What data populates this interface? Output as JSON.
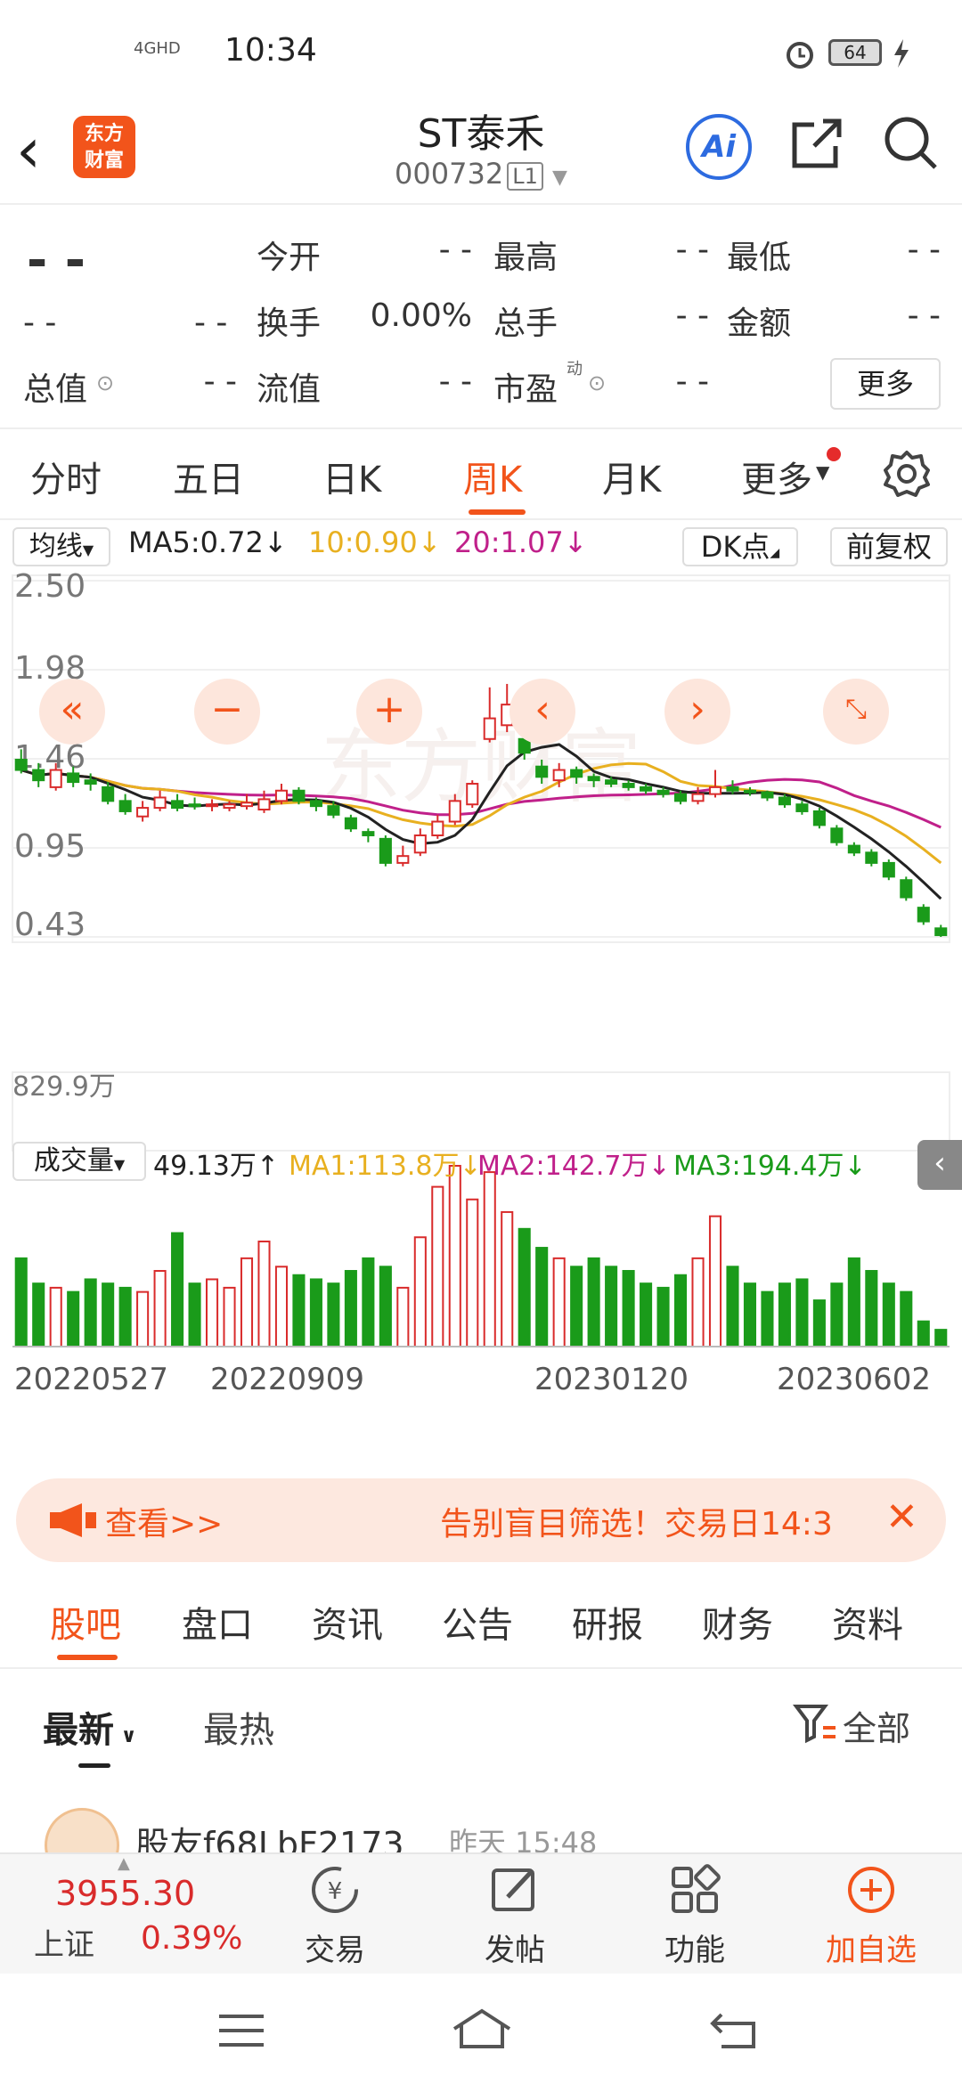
{
  "status_bar": {
    "time": "10:34",
    "network": "4GHD",
    "battery": "64"
  },
  "header": {
    "title": "ST泰禾",
    "code": "000732",
    "level": "L1",
    "logo_line1": "东方",
    "logo_line2": "财富",
    "ai_label": "Ai"
  },
  "quote": {
    "price": "- -",
    "change": "- -",
    "change_pct": "- -",
    "rows": [
      [
        {
          "label": "今开",
          "value": "- -"
        },
        {
          "label": "最高",
          "value": "- -"
        },
        {
          "label": "最低",
          "value": "- -"
        }
      ],
      [
        {
          "label": "换手",
          "value": "0.00%"
        },
        {
          "label": "总手",
          "value": "- -"
        },
        {
          "label": "金额",
          "value": "- -"
        }
      ],
      [
        {
          "label": "总值",
          "value": "- -"
        },
        {
          "label": "流值",
          "value": "- -"
        },
        {
          "label": "市盈",
          "value": "- -"
        }
      ]
    ],
    "pe_sup": "动",
    "more_label": "更多"
  },
  "chart_tabs": {
    "items": [
      "分时",
      "五日",
      "日K",
      "周K",
      "月K",
      "更多"
    ],
    "active": "周K"
  },
  "indicator": {
    "ma_type": "均线",
    "ma5": "MA5:0.72↓",
    "ma10": "10:0.90↓",
    "ma20": "20:1.07↓",
    "dk": "DK点",
    "fq": "前复权"
  },
  "price_axis": {
    "labels": [
      "2.50",
      "1.98",
      "1.46",
      "0.95",
      "0.43"
    ]
  },
  "volume": {
    "label": "成交量",
    "value": "49.13万↑",
    "ma1": "MA1:113.8万↓",
    "ma2": "MA2:142.7万↓",
    "ma3": "MA3:194.4万↓",
    "max_label": "829.9万"
  },
  "date_axis": [
    "20220527",
    "20220909",
    "20230120",
    "20230602"
  ],
  "colors": {
    "up": "#d92b2b",
    "down": "#1a9b1a",
    "ma5": "#222222",
    "ma10": "#e8b020",
    "ma20": "#c0208a",
    "accent": "#f2541b"
  },
  "chart_data": {
    "type": "candlestick",
    "ma5": 0.72,
    "ma10": 0.9,
    "ma20": 1.07,
    "ylim": [
      0.43,
      2.5
    ],
    "candles": [
      {
        "o": 1.46,
        "c": 1.4,
        "h": 1.52,
        "l": 1.38
      },
      {
        "o": 1.4,
        "c": 1.34,
        "h": 1.44,
        "l": 1.3
      },
      {
        "o": 1.3,
        "c": 1.4,
        "h": 1.44,
        "l": 1.28
      },
      {
        "o": 1.38,
        "c": 1.33,
        "h": 1.42,
        "l": 1.3
      },
      {
        "o": 1.34,
        "c": 1.32,
        "h": 1.38,
        "l": 1.28
      },
      {
        "o": 1.3,
        "c": 1.22,
        "h": 1.33,
        "l": 1.2
      },
      {
        "o": 1.22,
        "c": 1.16,
        "h": 1.26,
        "l": 1.14
      },
      {
        "o": 1.13,
        "c": 1.18,
        "h": 1.22,
        "l": 1.1
      },
      {
        "o": 1.18,
        "c": 1.24,
        "h": 1.28,
        "l": 1.16
      },
      {
        "o": 1.22,
        "c": 1.18,
        "h": 1.26,
        "l": 1.16
      },
      {
        "o": 1.2,
        "c": 1.19,
        "h": 1.24,
        "l": 1.17
      },
      {
        "o": 1.19,
        "c": 1.2,
        "h": 1.23,
        "l": 1.16
      },
      {
        "o": 1.18,
        "c": 1.2,
        "h": 1.22,
        "l": 1.16
      },
      {
        "o": 1.19,
        "c": 1.21,
        "h": 1.26,
        "l": 1.17
      },
      {
        "o": 1.17,
        "c": 1.23,
        "h": 1.28,
        "l": 1.15
      },
      {
        "o": 1.22,
        "c": 1.28,
        "h": 1.32,
        "l": 1.2
      },
      {
        "o": 1.28,
        "c": 1.22,
        "h": 1.3,
        "l": 1.2
      },
      {
        "o": 1.22,
        "c": 1.19,
        "h": 1.24,
        "l": 1.16
      },
      {
        "o": 1.19,
        "c": 1.14,
        "h": 1.22,
        "l": 1.12
      },
      {
        "o": 1.12,
        "c": 1.06,
        "h": 1.14,
        "l": 1.04
      },
      {
        "o": 1.04,
        "c": 1.02,
        "h": 1.06,
        "l": 0.98
      },
      {
        "o": 1.0,
        "c": 0.86,
        "h": 1.02,
        "l": 0.84
      },
      {
        "o": 0.86,
        "c": 0.9,
        "h": 0.96,
        "l": 0.84
      },
      {
        "o": 0.92,
        "c": 1.02,
        "h": 1.06,
        "l": 0.9
      },
      {
        "o": 1.02,
        "c": 1.1,
        "h": 1.14,
        "l": 1.0
      },
      {
        "o": 1.1,
        "c": 1.22,
        "h": 1.26,
        "l": 1.08
      },
      {
        "o": 1.2,
        "c": 1.32,
        "h": 1.34,
        "l": 1.18
      },
      {
        "o": 1.58,
        "c": 1.7,
        "h": 1.88,
        "l": 1.56
      },
      {
        "o": 1.66,
        "c": 1.78,
        "h": 1.9,
        "l": 1.62
      },
      {
        "o": 1.58,
        "c": 1.5,
        "h": 1.6,
        "l": 1.46
      },
      {
        "o": 1.42,
        "c": 1.36,
        "h": 1.46,
        "l": 1.32
      },
      {
        "o": 1.34,
        "c": 1.4,
        "h": 1.44,
        "l": 1.3
      },
      {
        "o": 1.4,
        "c": 1.36,
        "h": 1.42,
        "l": 1.32
      },
      {
        "o": 1.36,
        "c": 1.34,
        "h": 1.38,
        "l": 1.3
      },
      {
        "o": 1.34,
        "c": 1.32,
        "h": 1.36,
        "l": 1.3
      },
      {
        "o": 1.32,
        "c": 1.3,
        "h": 1.34,
        "l": 1.28
      },
      {
        "o": 1.3,
        "c": 1.28,
        "h": 1.32,
        "l": 1.26
      },
      {
        "o": 1.28,
        "c": 1.26,
        "h": 1.3,
        "l": 1.24
      },
      {
        "o": 1.26,
        "c": 1.22,
        "h": 1.28,
        "l": 1.2
      },
      {
        "o": 1.22,
        "c": 1.26,
        "h": 1.3,
        "l": 1.2
      },
      {
        "o": 1.26,
        "c": 1.3,
        "h": 1.4,
        "l": 1.24
      },
      {
        "o": 1.3,
        "c": 1.28,
        "h": 1.34,
        "l": 1.26
      },
      {
        "o": 1.28,
        "c": 1.27,
        "h": 1.3,
        "l": 1.25
      },
      {
        "o": 1.27,
        "c": 1.24,
        "h": 1.28,
        "l": 1.22
      },
      {
        "o": 1.24,
        "c": 1.2,
        "h": 1.26,
        "l": 1.18
      },
      {
        "o": 1.2,
        "c": 1.16,
        "h": 1.22,
        "l": 1.14
      },
      {
        "o": 1.16,
        "c": 1.08,
        "h": 1.18,
        "l": 1.06
      },
      {
        "o": 1.06,
        "c": 0.98,
        "h": 1.08,
        "l": 0.96
      },
      {
        "o": 0.96,
        "c": 0.92,
        "h": 0.98,
        "l": 0.9
      },
      {
        "o": 0.92,
        "c": 0.86,
        "h": 0.94,
        "l": 0.84
      },
      {
        "o": 0.86,
        "c": 0.78,
        "h": 0.88,
        "l": 0.76
      },
      {
        "o": 0.76,
        "c": 0.66,
        "h": 0.78,
        "l": 0.64
      },
      {
        "o": 0.6,
        "c": 0.52,
        "h": 0.62,
        "l": 0.5
      },
      {
        "o": 0.48,
        "c": 0.44,
        "h": 0.5,
        "l": 0.43
      }
    ],
    "volume": [
      420,
      300,
      280,
      260,
      320,
      300,
      280,
      260,
      360,
      540,
      300,
      320,
      280,
      420,
      500,
      380,
      340,
      320,
      300,
      360,
      420,
      380,
      280,
      520,
      760,
      860,
      700,
      829.9,
      640,
      560,
      470,
      420,
      380,
      420,
      380,
      360,
      300,
      280,
      340,
      420,
      620,
      380,
      300,
      260,
      300,
      320,
      220,
      300,
      420,
      360,
      300,
      260,
      120,
      80
    ]
  },
  "banner": {
    "left_text": "查看>>",
    "main_text": "告别盲目筛选！交易日14:3"
  },
  "info_tabs": {
    "items": [
      "股吧",
      "盘口",
      "资讯",
      "公告",
      "研报",
      "财务",
      "资料"
    ],
    "active": "股吧"
  },
  "sort": {
    "latest": "最新",
    "hot": "最热",
    "filter": "全部"
  },
  "post": {
    "user": "股友f68LbF2173",
    "time": "昨天 15:48"
  },
  "bottom_bar": {
    "index_value": "3955.30",
    "index_name": "上证",
    "index_pct": "0.39%",
    "items": [
      "交易",
      "发帖",
      "功能",
      "加自选"
    ]
  }
}
